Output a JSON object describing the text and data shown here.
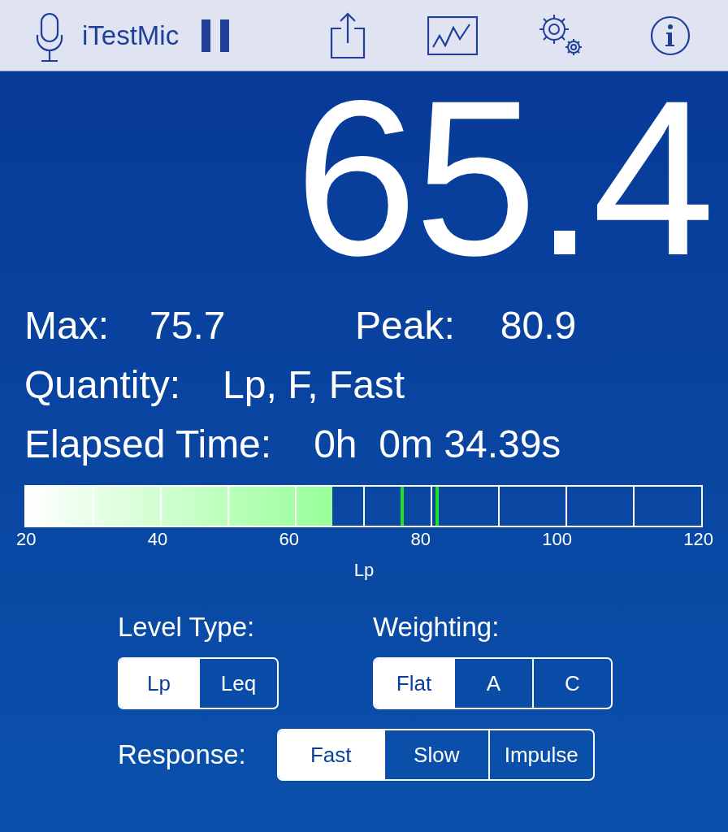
{
  "toolbar": {
    "app_name": "iTestMic",
    "paused": true
  },
  "reading": "65.4",
  "stats": [
    {
      "label": "Max:",
      "value": "75.7"
    },
    {
      "label": "Peak:",
      "value": "80.9"
    }
  ],
  "quantity": {
    "label": "Quantity:",
    "value": "Lp, F, Fast"
  },
  "elapsed": {
    "label": "Elapsed Time:",
    "value": "0h  0m 34.39s"
  },
  "meter": {
    "level": 0.454,
    "max_marker": {
      "level": 0.557
    },
    "peak_marker": {
      "level": 0.609
    },
    "ticks": [
      "20",
      "40",
      "60",
      "80",
      "100",
      "120"
    ],
    "axis_label": "Lp"
  },
  "level_type": {
    "label": "Level Type:",
    "options": [
      {
        "label": "Lp",
        "selected": true
      },
      {
        "label": "Leq",
        "selected": false
      }
    ]
  },
  "weighting": {
    "label": "Weighting:",
    "options": [
      {
        "label": "Flat",
        "selected": true
      },
      {
        "label": "A",
        "selected": false
      },
      {
        "label": "C",
        "selected": false
      }
    ]
  },
  "response": {
    "label": "Response:",
    "options": [
      {
        "label": "Fast",
        "selected": true
      },
      {
        "label": "Slow",
        "selected": false
      },
      {
        "label": "Impulse",
        "selected": false
      }
    ]
  }
}
